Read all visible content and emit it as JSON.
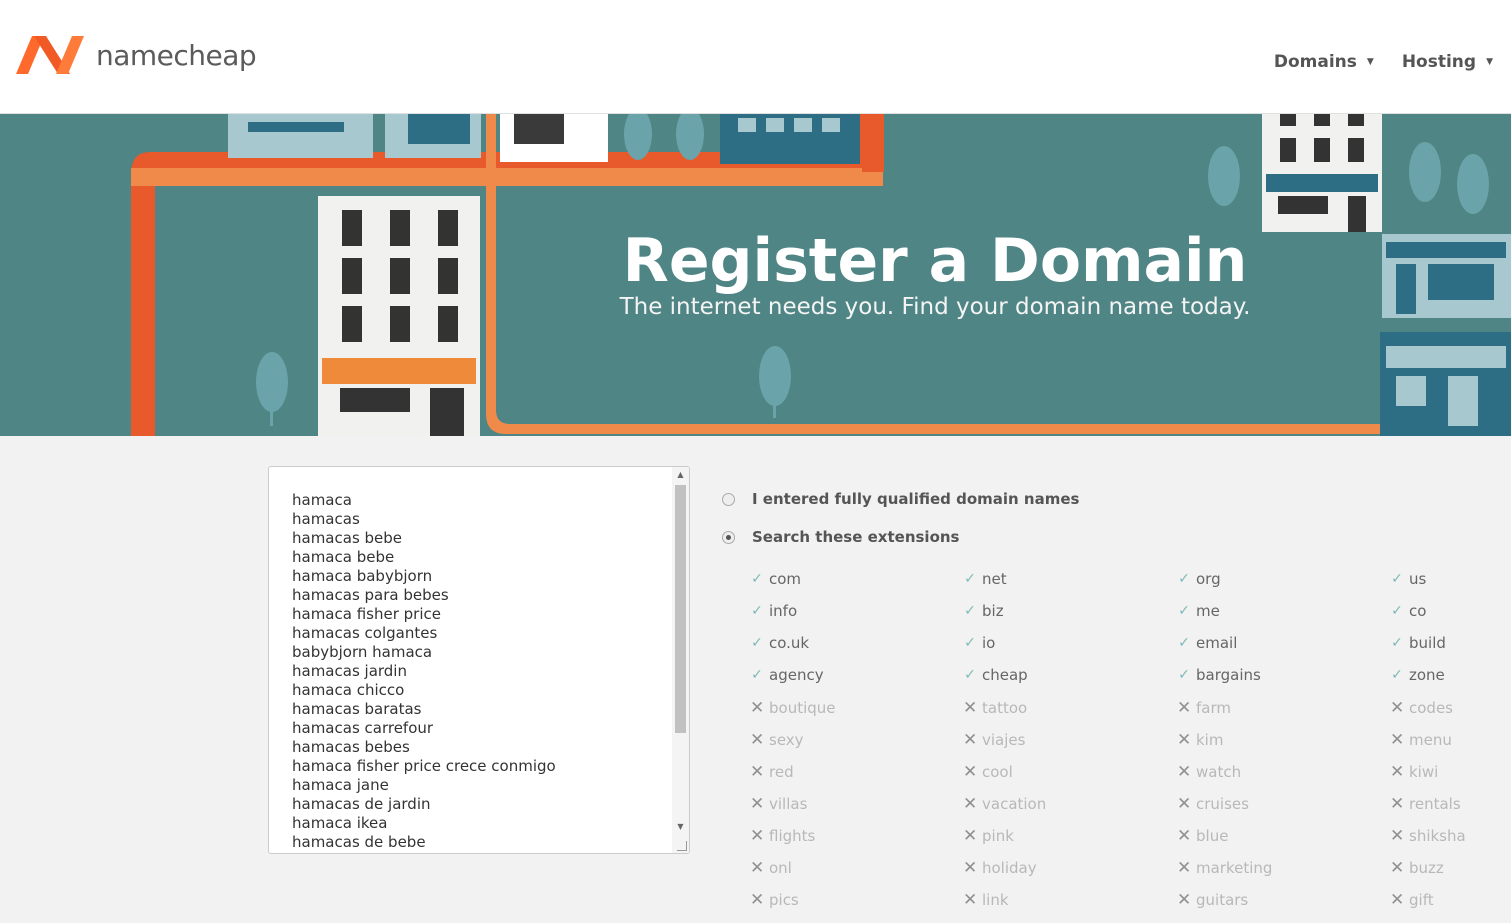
{
  "header": {
    "logo_text": "namecheap",
    "brand_color": "#f15a24",
    "nav": [
      {
        "label": "Domains"
      },
      {
        "label": "Hosting"
      }
    ]
  },
  "hero": {
    "title": "Register a Domain",
    "subtitle": "The internet needs you. Find your domain name today."
  },
  "domain_list": [
    "hamaca",
    "hamacas",
    "hamacas bebe",
    "hamaca bebe",
    "hamaca babybjorn",
    "hamacas para bebes",
    "hamaca fisher price",
    "hamacas colgantes",
    "babybjorn hamaca",
    "hamacas jardin",
    "hamaca chicco",
    "hamacas baratas",
    "hamacas carrefour",
    "hamacas bebes",
    "hamaca fisher price crece conmigo",
    "hamaca jane",
    "hamacas de jardin",
    "hamaca ikea",
    "hamacas de bebe"
  ],
  "options": {
    "fully_qualified_label": "I entered fully qualified domain names",
    "search_extensions_label": "Search these extensions",
    "selected": "search_extensions"
  },
  "extensions": [
    [
      "com",
      "net",
      "org",
      "us"
    ],
    [
      "info",
      "biz",
      "me",
      "co"
    ],
    [
      "co.uk",
      "io",
      "email",
      "build"
    ],
    [
      "agency",
      "cheap",
      "bargains",
      "zone"
    ],
    [
      "boutique",
      "tattoo",
      "farm",
      "codes"
    ],
    [
      "sexy",
      "viajes",
      "kim",
      "menu"
    ],
    [
      "red",
      "cool",
      "watch",
      "kiwi"
    ],
    [
      "villas",
      "vacation",
      "cruises",
      "rentals"
    ],
    [
      "flights",
      "pink",
      "blue",
      "shiksha"
    ],
    [
      "onl",
      "holiday",
      "marketing",
      "buzz"
    ],
    [
      "pics",
      "link",
      "guitars",
      "gift"
    ]
  ],
  "extensions_checked_rows": 4
}
